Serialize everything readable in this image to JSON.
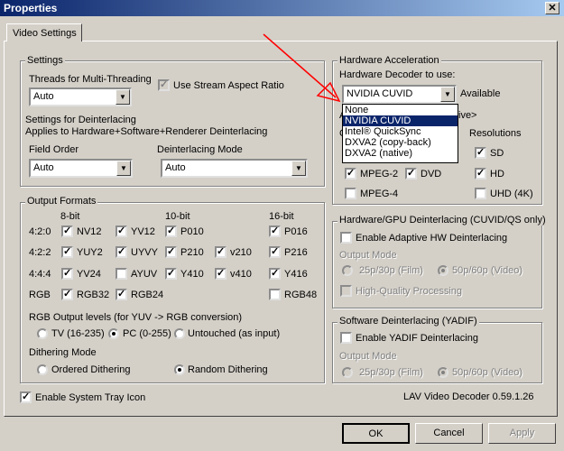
{
  "window": {
    "title": "Properties",
    "close_icon": "close-icon"
  },
  "tab": {
    "label": "Video Settings"
  },
  "settings": {
    "title": "Settings",
    "threads_label": "Threads for Multi-Threading",
    "threads_value": "Auto",
    "stream_aspect_label": "Use Stream Aspect Ratio",
    "deint_title": "Settings for Deinterlacing",
    "deint_desc": "Applies to Hardware+Software+Renderer Deinterlacing",
    "field_order_label": "Field Order",
    "field_order_value": "Auto",
    "deint_mode_label": "Deinterlacing Mode",
    "deint_mode_value": "Auto"
  },
  "output": {
    "title": "Output Formats",
    "bit8": "8-bit",
    "bit10": "10-bit",
    "bit16": "16-bit",
    "rows": [
      "4:2:0",
      "4:2:2",
      "4:4:4",
      "RGB"
    ],
    "f_nv12": "NV12",
    "f_yv12": "YV12",
    "f_p010": "P010",
    "f_p016": "P016",
    "f_yuy2": "YUY2",
    "f_uyvy": "UYVY",
    "f_p210": "P210",
    "f_v210": "v210",
    "f_p216": "P216",
    "f_yv24": "YV24",
    "f_ayuv": "AYUV",
    "f_y410": "Y410",
    "f_v410": "v410",
    "f_y416": "Y416",
    "f_rgb32": "RGB32",
    "f_rgb24": "RGB24",
    "f_rgb48": "RGB48",
    "levels_label": "RGB Output levels (for YUV -> RGB conversion)",
    "levels_tv": "TV (16-235)",
    "levels_pc": "PC (0-255)",
    "levels_untouched": "Untouched (as input)",
    "dither_label": "Dithering Mode",
    "dither_ordered": "Ordered Dithering",
    "dither_random": "Random Dithering"
  },
  "tray": {
    "label": "Enable System Tray Icon"
  },
  "hw": {
    "title": "Hardware Acceleration",
    "decoder_label": "Hardware Decoder to use:",
    "decoder_value": "NVIDIA CUVID",
    "available": "Available",
    "options": [
      "None",
      "NVIDIA CUVID",
      "Intel® QuickSync",
      "DXVA2 (copy-back)",
      "DXVA2 (native)"
    ],
    "partial_a": "A",
    "partial_ive": "ive>",
    "partial_c": "C",
    "resolutions": "Resolutions",
    "mpeg2": "MPEG-2",
    "dvd": "DVD",
    "mpeg4": "MPEG-4",
    "sd": "SD",
    "hd": "HD",
    "uhd": "UHD (4K)"
  },
  "gpu_deint": {
    "title": "Hardware/GPU Deinterlacing (CUVID/QS only)",
    "enable": "Enable Adaptive HW Deinterlacing",
    "output_mode": "Output Mode",
    "film": "25p/30p (Film)",
    "video": "50p/60p (Video)",
    "hq": "High-Quality Processing"
  },
  "sw_deint": {
    "title": "Software Deinterlacing (YADIF)",
    "enable": "Enable YADIF Deinterlacing",
    "output_mode": "Output Mode",
    "film": "25p/30p (Film)",
    "video": "50p/60p (Video)"
  },
  "version": "LAV Video Decoder 0.59.1.26",
  "buttons": {
    "ok": "OK",
    "cancel": "Cancel",
    "apply": "Apply"
  },
  "annotation": {
    "color": "#ff0000",
    "icon": "red-arrow"
  }
}
